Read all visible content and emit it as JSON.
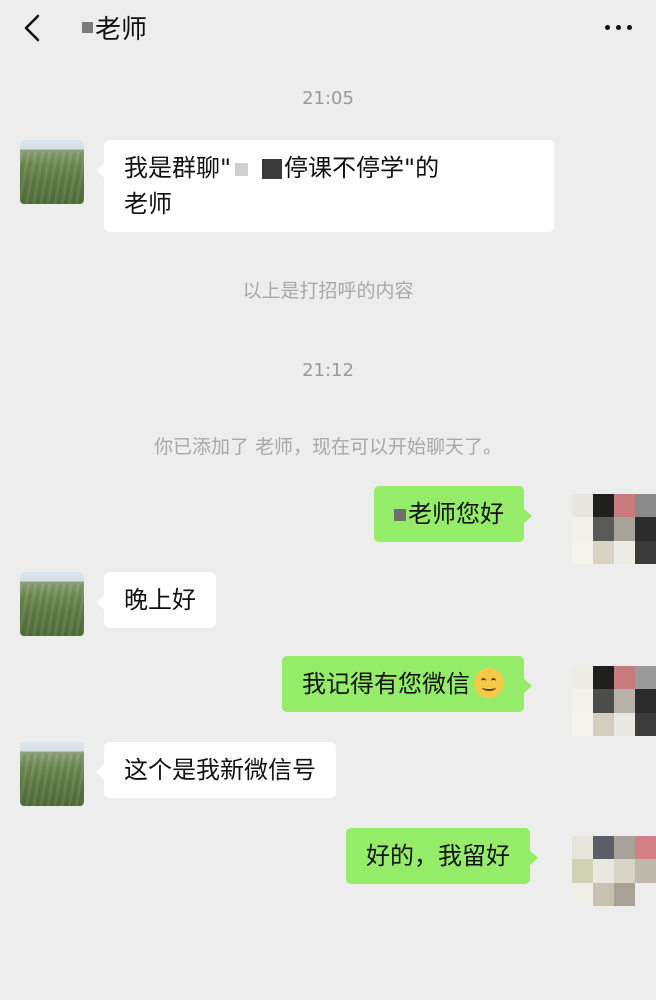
{
  "header": {
    "title": "老师",
    "back_icon": "chevron-left-icon",
    "more_icon": "more-dots-icon"
  },
  "timestamps": [
    "21:05",
    "21:12"
  ],
  "system_messages": {
    "greeting_note": "以上是打招呼的内容",
    "added_note": "你已添加了 老师，现在可以开始聊天了。"
  },
  "messages": [
    {
      "side": "left",
      "line1_prefix": "我是群聊\"",
      "line1_suffix": "停课不停学\"的",
      "line2": "老师"
    },
    {
      "side": "right",
      "text": "老师您好"
    },
    {
      "side": "left",
      "text": "晚上好"
    },
    {
      "side": "right",
      "text": "我记得有您微信",
      "emoji": "smile-emoji"
    },
    {
      "side": "left",
      "text": "这个是我新微信号"
    },
    {
      "side": "right",
      "text": "好的，我留好"
    }
  ],
  "colors": {
    "background": "#ededed",
    "incoming_bubble": "#ffffff",
    "outgoing_bubble": "#95ec69"
  }
}
